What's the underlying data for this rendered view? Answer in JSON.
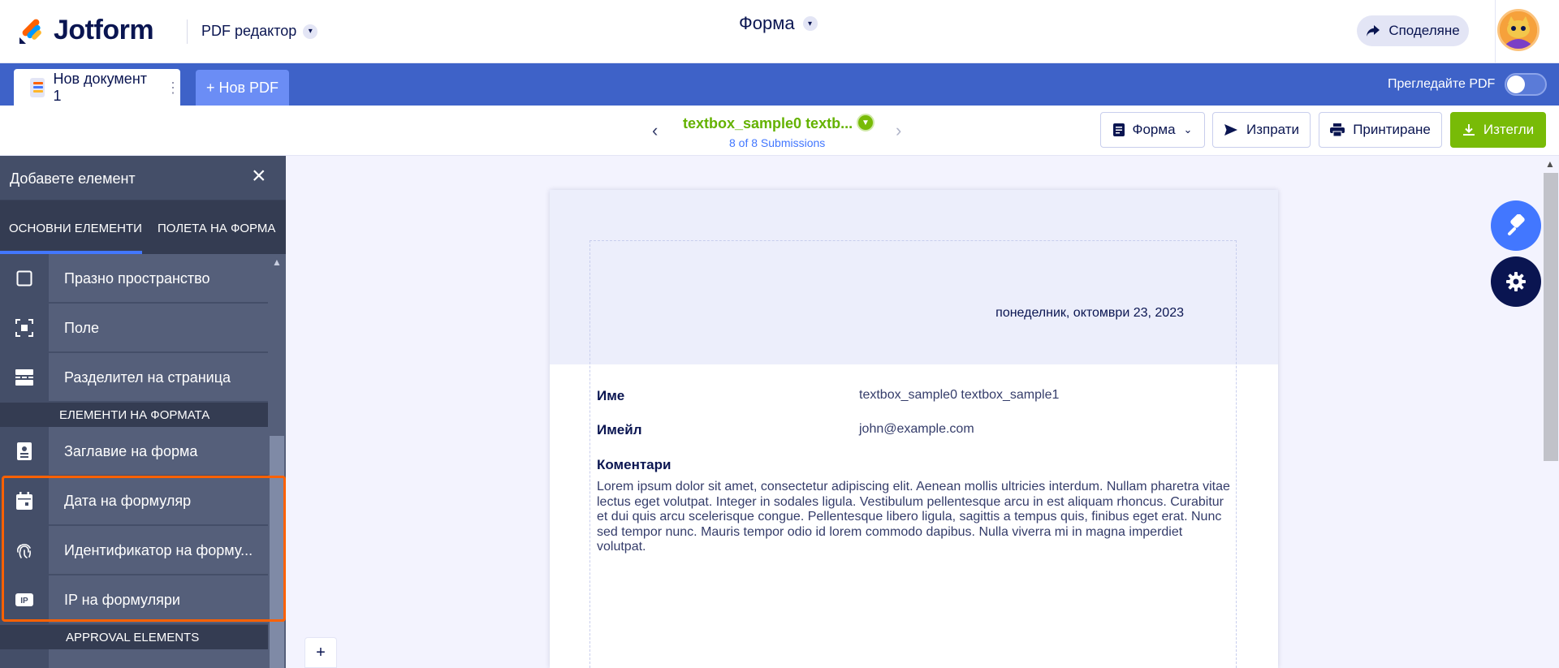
{
  "app": {
    "brand": "Jotform",
    "editor_label": "PDF редактор",
    "form_title": "Форма",
    "share_label": "Споделяне"
  },
  "tabs": {
    "document": "Нов документ 1",
    "new_pdf": "+ Нов PDF",
    "preview_label": "Прегледайте PDF"
  },
  "toolbar": {
    "submission_title": "textbox_sample0 textb...",
    "submission_count": "8 of 8 Submissions",
    "form_button": "Форма",
    "send_button": "Изпрати",
    "print_button": "Принтиране",
    "download_button": "Изтегли"
  },
  "panel": {
    "title": "Добавете елемент",
    "tab_basic": "ОСНОВНИ ЕЛЕМЕНТИ",
    "tab_fields": "ПОЛЕТА НА ФОРМА",
    "items": [
      {
        "label": "Празно пространство",
        "icon": "blank-space-icon"
      },
      {
        "label": "Поле",
        "icon": "field-icon"
      },
      {
        "label": "Разделител на страница",
        "icon": "page-break-icon"
      }
    ],
    "section_form": "ЕЛЕМЕНТИ НА ФОРМАТА",
    "form_items": [
      {
        "label": "Заглавие на форма",
        "icon": "form-title-icon"
      },
      {
        "label": "Дата на формуляр",
        "icon": "calendar-icon"
      },
      {
        "label": "Идентификатор на форму...",
        "icon": "fingerprint-icon"
      },
      {
        "label": "IP на формуляри",
        "icon": "ip-icon"
      }
    ],
    "section_approval": "APPROVAL ELEMENTS"
  },
  "document": {
    "date": "понеделник, октомври 23, 2023",
    "fields": [
      {
        "label": "Име",
        "value": "textbox_sample0 textbox_sample1"
      },
      {
        "label": "Имейл",
        "value": "john@example.com"
      }
    ],
    "comments_label": "Коментари",
    "comments_text": "Lorem ipsum dolor sit amet, consectetur adipiscing elit. Aenean mollis ultricies interdum. Nullam pharetra vitae lectus eget volutpat. Integer in sodales ligula. Vestibulum pellentesque arcu in est aliquam rhoncus. Curabitur et dui quis arcu scelerisque congue. Pellentesque libero ligula, sagittis a tempus quis, finibus eget erat. Nunc sed tempor nunc. Mauris tempor odio id lorem commodo dapibus. Nulla viverra mi in magna imperdiet volutpat."
  },
  "add_page_label": "+",
  "colors": {
    "accent": "#4277ff",
    "tabbar": "#3e62c8",
    "success": "#78bb07",
    "highlight": "#ff6100",
    "panel": "#444e68"
  }
}
